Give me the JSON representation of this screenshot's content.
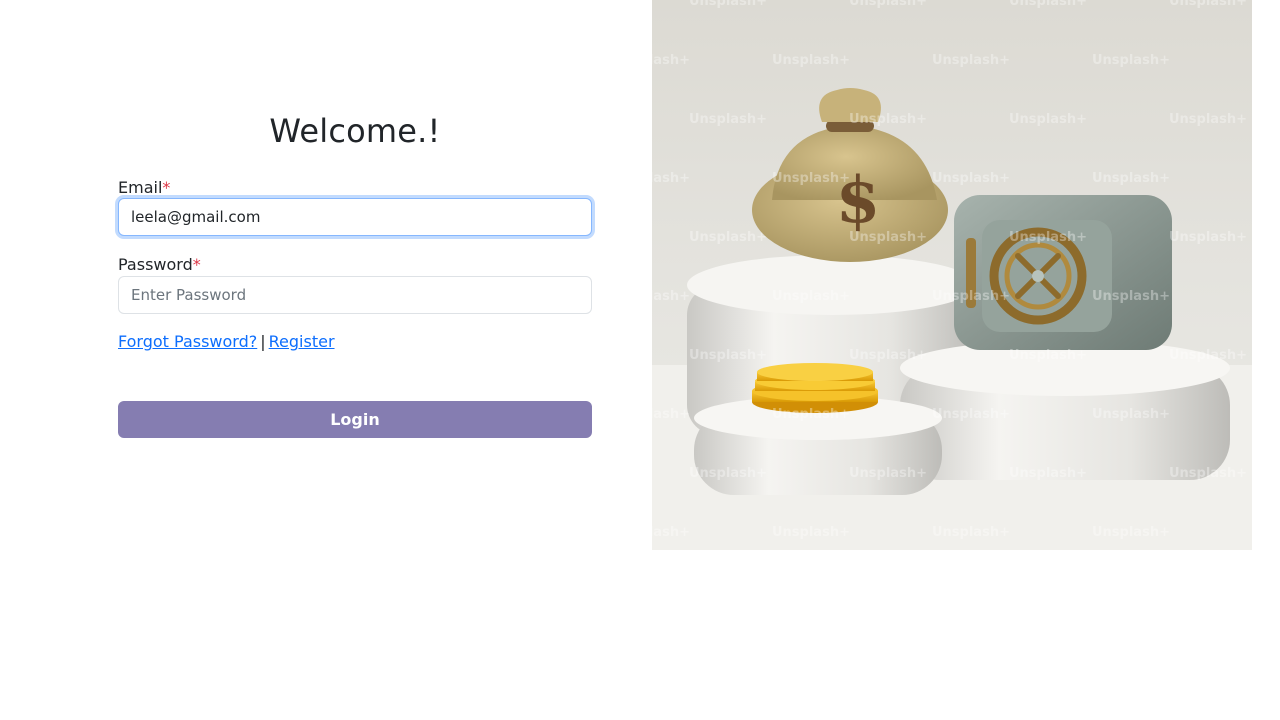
{
  "login": {
    "heading": "Welcome.!",
    "email_label": "Email",
    "email_value": "leela@gmail.com",
    "password_label": "Password",
    "password_placeholder": "Enter Password",
    "required_marker": "*",
    "forgot_link": "Forgot Password?",
    "separator": "|",
    "register_link": "Register",
    "login_button": "Login"
  },
  "hero": {
    "watermark_text": "Unsplash+",
    "icons": [
      "money-bag-icon",
      "safe-icon",
      "coin-stack-icon"
    ]
  },
  "colors": {
    "login_button": "#857db1",
    "link": "#0d6efd",
    "required": "#dc3545",
    "focus_border": "#86b7fe"
  }
}
